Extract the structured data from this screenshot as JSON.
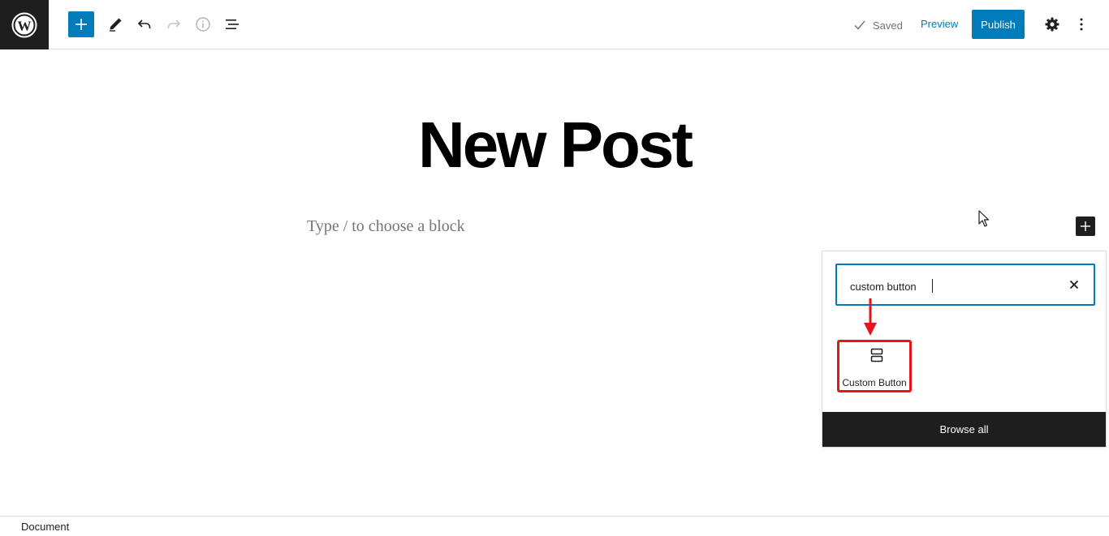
{
  "toolbar": {
    "logo_icon": "wordpress-logo-icon",
    "inserter_icon": "plus-icon",
    "tools_icon": "pencil-icon",
    "undo_icon": "undo-icon",
    "redo_icon": "redo-icon",
    "details_icon": "info-icon",
    "list_view_icon": "list-view-icon",
    "saved_label": "Saved",
    "preview_label": "Preview",
    "publish_label": "Publish",
    "settings_icon": "gear-icon",
    "options_icon": "more-vertical-icon",
    "accent_color": "#007cba"
  },
  "editor": {
    "post_title": "New Post",
    "block_placeholder": "Type / to choose a block",
    "side_inserter_icon": "plus-icon"
  },
  "quick_inserter": {
    "search_value": "custom button",
    "clear_icon": "close-icon",
    "results": [
      {
        "label": "Custom Button",
        "icon": "button-block-icon"
      }
    ],
    "browse_all_label": "Browse all",
    "highlight_color": "#e2161b"
  },
  "footer": {
    "breadcrumb": "Document"
  }
}
